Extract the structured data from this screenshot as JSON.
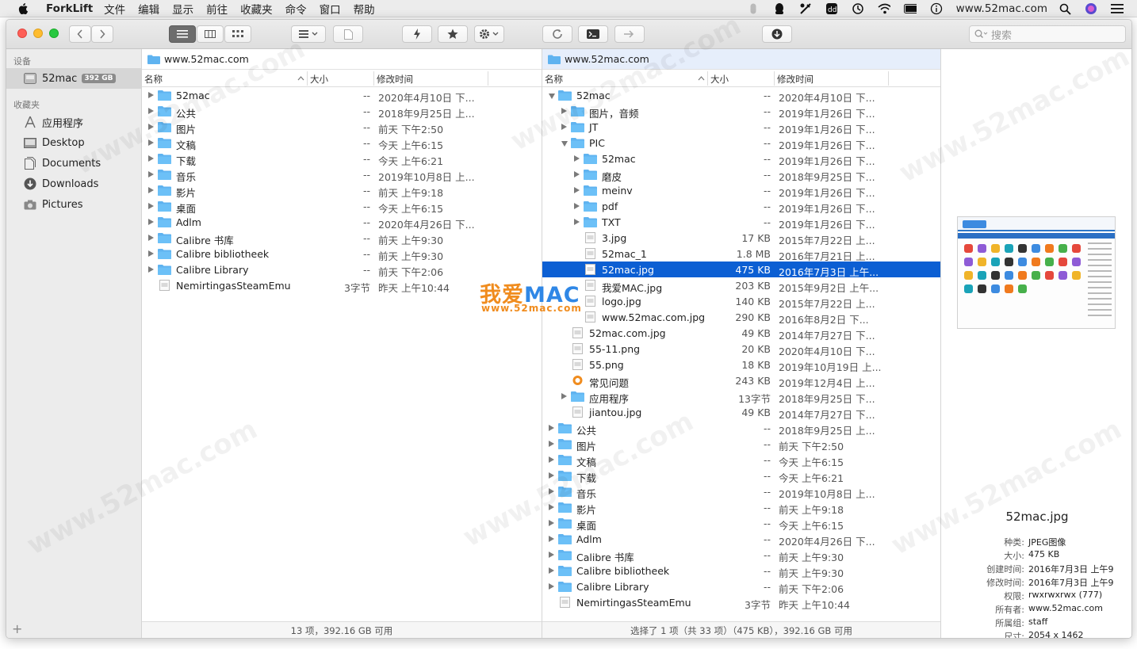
{
  "menubar": {
    "app_name": "ForkLift",
    "menus": [
      "文件",
      "编辑",
      "显示",
      "前往",
      "收藏夹",
      "命令",
      "窗口",
      "帮助"
    ],
    "domain": "www.52mac.com"
  },
  "toolbar": {
    "search_placeholder": "搜索"
  },
  "sidebar": {
    "devices_header": "设备",
    "device": {
      "label": "52mac",
      "badge": "392 GB"
    },
    "favorites_header": "收藏夹",
    "favorites": [
      {
        "label": "应用程序",
        "icon": "applications-icon"
      },
      {
        "label": "Desktop",
        "icon": "desktop-icon"
      },
      {
        "label": "Documents",
        "icon": "documents-icon"
      },
      {
        "label": "Downloads",
        "icon": "downloads-icon"
      },
      {
        "label": "Pictures",
        "icon": "pictures-icon"
      }
    ],
    "add_label": "+"
  },
  "left_pane": {
    "path": "www.52mac.com",
    "columns": {
      "name": "名称",
      "size": "大小",
      "modified": "修改时间"
    },
    "rows": [
      {
        "name": "52mac",
        "size": "--",
        "date": "2020年4月10日 下...",
        "kind": "folder",
        "disclosure": true
      },
      {
        "name": "公共",
        "size": "--",
        "date": "2018年9月25日 上...",
        "kind": "folder",
        "disclosure": true
      },
      {
        "name": "图片",
        "size": "--",
        "date": "前天 下午2:50",
        "kind": "folder",
        "disclosure": true
      },
      {
        "name": "文稿",
        "size": "--",
        "date": "今天 上午6:15",
        "kind": "folder",
        "disclosure": true
      },
      {
        "name": "下载",
        "size": "--",
        "date": "今天 上午6:21",
        "kind": "folder",
        "disclosure": true
      },
      {
        "name": "音乐",
        "size": "--",
        "date": "2019年10月8日 上...",
        "kind": "folder",
        "disclosure": true
      },
      {
        "name": "影片",
        "size": "--",
        "date": "前天 上午9:18",
        "kind": "folder",
        "disclosure": true
      },
      {
        "name": "桌面",
        "size": "--",
        "date": "今天 上午6:15",
        "kind": "folder",
        "disclosure": true
      },
      {
        "name": "Adlm",
        "size": "--",
        "date": "2020年4月26日 下...",
        "kind": "folder",
        "disclosure": true
      },
      {
        "name": "Calibre 书库",
        "size": "--",
        "date": "前天 上午9:30",
        "kind": "folder",
        "disclosure": true
      },
      {
        "name": "Calibre bibliotheek",
        "size": "--",
        "date": "前天 上午9:30",
        "kind": "folder",
        "disclosure": true
      },
      {
        "name": "Calibre Library",
        "size": "--",
        "date": "前天 下午2:06",
        "kind": "folder",
        "disclosure": true
      },
      {
        "name": "NemirtingasSteamEmu",
        "size": "3字节",
        "date": "昨天 上午10:44",
        "kind": "file",
        "disclosure": false
      }
    ],
    "status": "13 项，392.16 GB 可用"
  },
  "right_pane": {
    "path": "www.52mac.com",
    "columns": {
      "name": "名称",
      "size": "大小",
      "modified": "修改时间"
    },
    "rows": [
      {
        "name": "52mac",
        "size": "--",
        "date": "2020年4月10日 下...",
        "kind": "folder",
        "level": 0,
        "disclosure": "open"
      },
      {
        "name": "图片，音频",
        "size": "--",
        "date": "2019年1月26日 下...",
        "kind": "folder",
        "level": 1,
        "disclosure": "closed"
      },
      {
        "name": "JT",
        "size": "--",
        "date": "2019年1月26日 下...",
        "kind": "folder",
        "level": 1,
        "disclosure": "closed"
      },
      {
        "name": "PIC",
        "size": "--",
        "date": "2019年1月26日 下...",
        "kind": "folder",
        "level": 1,
        "disclosure": "open"
      },
      {
        "name": "52mac",
        "size": "--",
        "date": "2019年1月26日 下...",
        "kind": "folder",
        "level": 2,
        "disclosure": "closed"
      },
      {
        "name": "磨皮",
        "size": "--",
        "date": "2018年9月25日 下...",
        "kind": "folder",
        "level": 2,
        "disclosure": "closed"
      },
      {
        "name": "meinv",
        "size": "--",
        "date": "2019年1月26日 下...",
        "kind": "folder",
        "level": 2,
        "disclosure": "closed"
      },
      {
        "name": "pdf",
        "size": "--",
        "date": "2019年1月26日 下...",
        "kind": "folder",
        "level": 2,
        "disclosure": "closed"
      },
      {
        "name": "TXT",
        "size": "--",
        "date": "2019年1月26日 下...",
        "kind": "folder",
        "level": 2,
        "disclosure": "closed"
      },
      {
        "name": "3.jpg",
        "size": "17 KB",
        "date": "2015年7月22日 上...",
        "kind": "file",
        "level": 2,
        "disclosure": "none"
      },
      {
        "name": "52mac_1",
        "size": "1.8 MB",
        "date": "2016年7月21日 上...",
        "kind": "file",
        "level": 2,
        "disclosure": "none"
      },
      {
        "name": "52mac.jpg",
        "size": "475 KB",
        "date": "2016年7月3日 上午...",
        "kind": "file",
        "level": 2,
        "disclosure": "none",
        "selected": true
      },
      {
        "name": "我爱MAC.jpg",
        "size": "203 KB",
        "date": "2015年9月2日 上午...",
        "kind": "file",
        "level": 2,
        "disclosure": "none"
      },
      {
        "name": "logo.jpg",
        "size": "140 KB",
        "date": "2015年7月22日 上...",
        "kind": "file",
        "level": 2,
        "disclosure": "none"
      },
      {
        "name": "www.52mac.com.jpg",
        "size": "290 KB",
        "date": "2016年8月2日 下...",
        "kind": "file",
        "level": 2,
        "disclosure": "none"
      },
      {
        "name": "52mac.com.jpg",
        "size": "49 KB",
        "date": "2014年7月27日 下...",
        "kind": "file",
        "level": 1,
        "disclosure": "none"
      },
      {
        "name": "55-11.png",
        "size": "20 KB",
        "date": "2020年4月10日 下...",
        "kind": "file",
        "level": 1,
        "disclosure": "none"
      },
      {
        "name": "55.png",
        "size": "18 KB",
        "date": "2019年10月19日 上...",
        "kind": "file",
        "level": 1,
        "disclosure": "none"
      },
      {
        "name": "常见问题",
        "size": "243 KB",
        "date": "2019年12月4日 上...",
        "kind": "app",
        "level": 1,
        "disclosure": "none"
      },
      {
        "name": "应用程序",
        "size": "13字节",
        "date": "2018年9月25日 下...",
        "kind": "folder",
        "level": 1,
        "disclosure": "closed"
      },
      {
        "name": "jiantou.jpg",
        "size": "49 KB",
        "date": "2014年7月27日 下...",
        "kind": "file",
        "level": 1,
        "disclosure": "none"
      },
      {
        "name": "公共",
        "size": "--",
        "date": "2018年9月25日 上...",
        "kind": "folder",
        "level": 0,
        "disclosure": "closed"
      },
      {
        "name": "图片",
        "size": "--",
        "date": "前天 下午2:50",
        "kind": "folder",
        "level": 0,
        "disclosure": "closed"
      },
      {
        "name": "文稿",
        "size": "--",
        "date": "今天 上午6:15",
        "kind": "folder",
        "level": 0,
        "disclosure": "closed"
      },
      {
        "name": "下载",
        "size": "--",
        "date": "今天 上午6:21",
        "kind": "folder",
        "level": 0,
        "disclosure": "closed"
      },
      {
        "name": "音乐",
        "size": "--",
        "date": "2019年10月8日 上...",
        "kind": "folder",
        "level": 0,
        "disclosure": "closed"
      },
      {
        "name": "影片",
        "size": "--",
        "date": "前天 上午9:18",
        "kind": "folder",
        "level": 0,
        "disclosure": "closed"
      },
      {
        "name": "桌面",
        "size": "--",
        "date": "今天 上午6:15",
        "kind": "folder",
        "level": 0,
        "disclosure": "closed"
      },
      {
        "name": "Adlm",
        "size": "--",
        "date": "2020年4月26日 下...",
        "kind": "folder",
        "level": 0,
        "disclosure": "closed"
      },
      {
        "name": "Calibre 书库",
        "size": "--",
        "date": "前天 上午9:30",
        "kind": "folder",
        "level": 0,
        "disclosure": "closed"
      },
      {
        "name": "Calibre bibliotheek",
        "size": "--",
        "date": "前天 上午9:30",
        "kind": "folder",
        "level": 0,
        "disclosure": "closed"
      },
      {
        "name": "Calibre Library",
        "size": "--",
        "date": "前天 下午2:06",
        "kind": "folder",
        "level": 0,
        "disclosure": "closed"
      },
      {
        "name": "NemirtingasSteamEmu",
        "size": "3字节",
        "date": "昨天 上午10:44",
        "kind": "file",
        "level": 0,
        "disclosure": "none"
      }
    ],
    "status": "选择了 1 项（共 33 项）（475 KB），392.16 GB 可用"
  },
  "preview": {
    "filename": "52mac.jpg",
    "info": [
      {
        "key": "种类:",
        "value": "JPEG图像"
      },
      {
        "key": "大小:",
        "value": "475 KB"
      },
      {
        "key": "创建时间:",
        "value": "2016年7月3日 上午9"
      },
      {
        "key": "修改时间:",
        "value": "2016年7月3日 上午9"
      },
      {
        "key": "权限:",
        "value": "rwxrwxrwx (777)"
      },
      {
        "key": "所有者:",
        "value": "www.52mac.com"
      },
      {
        "key": "所属组:",
        "value": "staff"
      },
      {
        "key": "尺寸:",
        "value": "2054 x 1462"
      }
    ]
  },
  "watermark": {
    "logo_text_cn": "我爱",
    "logo_text_mac": "MAC",
    "logo_url": "www.52mac.com",
    "background_text": "www.52mac.com"
  },
  "colors": {
    "selection": "#0c5fd3",
    "folder": "#5fb3f0",
    "watermark_orange": "#f08c1e",
    "watermark_blue": "#2f87e6"
  }
}
